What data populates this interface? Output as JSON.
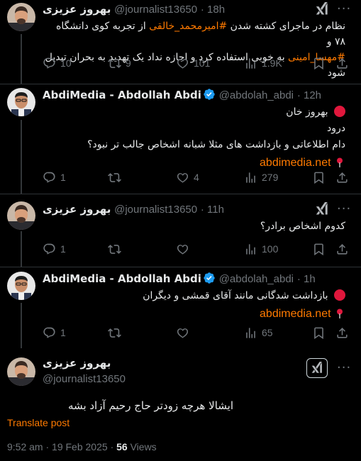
{
  "colors": {
    "accent": "#ff7a00",
    "muted": "#71767b",
    "verified": "#1d9bf0",
    "text": "#e7e9ea"
  },
  "tweets": [
    {
      "name": "بهروز عزیزی",
      "handle": "@journalist13650",
      "time": "· 18h",
      "lines": [
        {
          "pre": "نظام در ماجرای کشته شدن ",
          "tag": "#امیرمحمد_خالقی",
          "post": " از تجربه کوی دانشگاه ۷۸ و"
        },
        {
          "pre": "",
          "tag": "#مهسا_امینی",
          "post": " به خوبی استفاده کرد و اجازه نداد یک تهدید به بحران تبدیل شود"
        }
      ],
      "replies": "10",
      "reposts": "9",
      "likes": "101",
      "views": "1.9K"
    },
    {
      "name": "AbdiMedia - Abdollah Abdi",
      "handle": "@abdolah_abdi",
      "time": "· 12h",
      "lines": [
        "بهروز خان",
        "درود",
        "دام اطلاعاتی و بازداشت های مثلا شبانه اشخاص جالب تر نبود؟"
      ],
      "link": "abdimedia.net",
      "replies": "1",
      "reposts": "",
      "likes": "4",
      "views": "279"
    },
    {
      "name": "بهروز عزیزی",
      "handle": "@journalist13650",
      "time": "· 11h",
      "lines": [
        "کدوم اشخاص برادر؟"
      ],
      "replies": "1",
      "reposts": "",
      "likes": "",
      "views": "100"
    },
    {
      "name": "AbdiMedia - Abdollah Abdi",
      "handle": "@abdolah_abdi",
      "time": "· 1h",
      "lines": [
        "بازداشت شدگانی مانند آقای قمشی و دیگران"
      ],
      "link": "abdimedia.net",
      "replies": "1",
      "reposts": "",
      "likes": "",
      "views": "65"
    }
  ],
  "main": {
    "name": "بهروز عزیزی",
    "handle": "@journalist13650",
    "text": "ایشالا هرچه زودتر حاج رحیم آزاد بشه",
    "translate": "Translate post",
    "time": "9:52 am",
    "date": "19 Feb 2025",
    "views_count": "56",
    "views_label": "Views"
  }
}
